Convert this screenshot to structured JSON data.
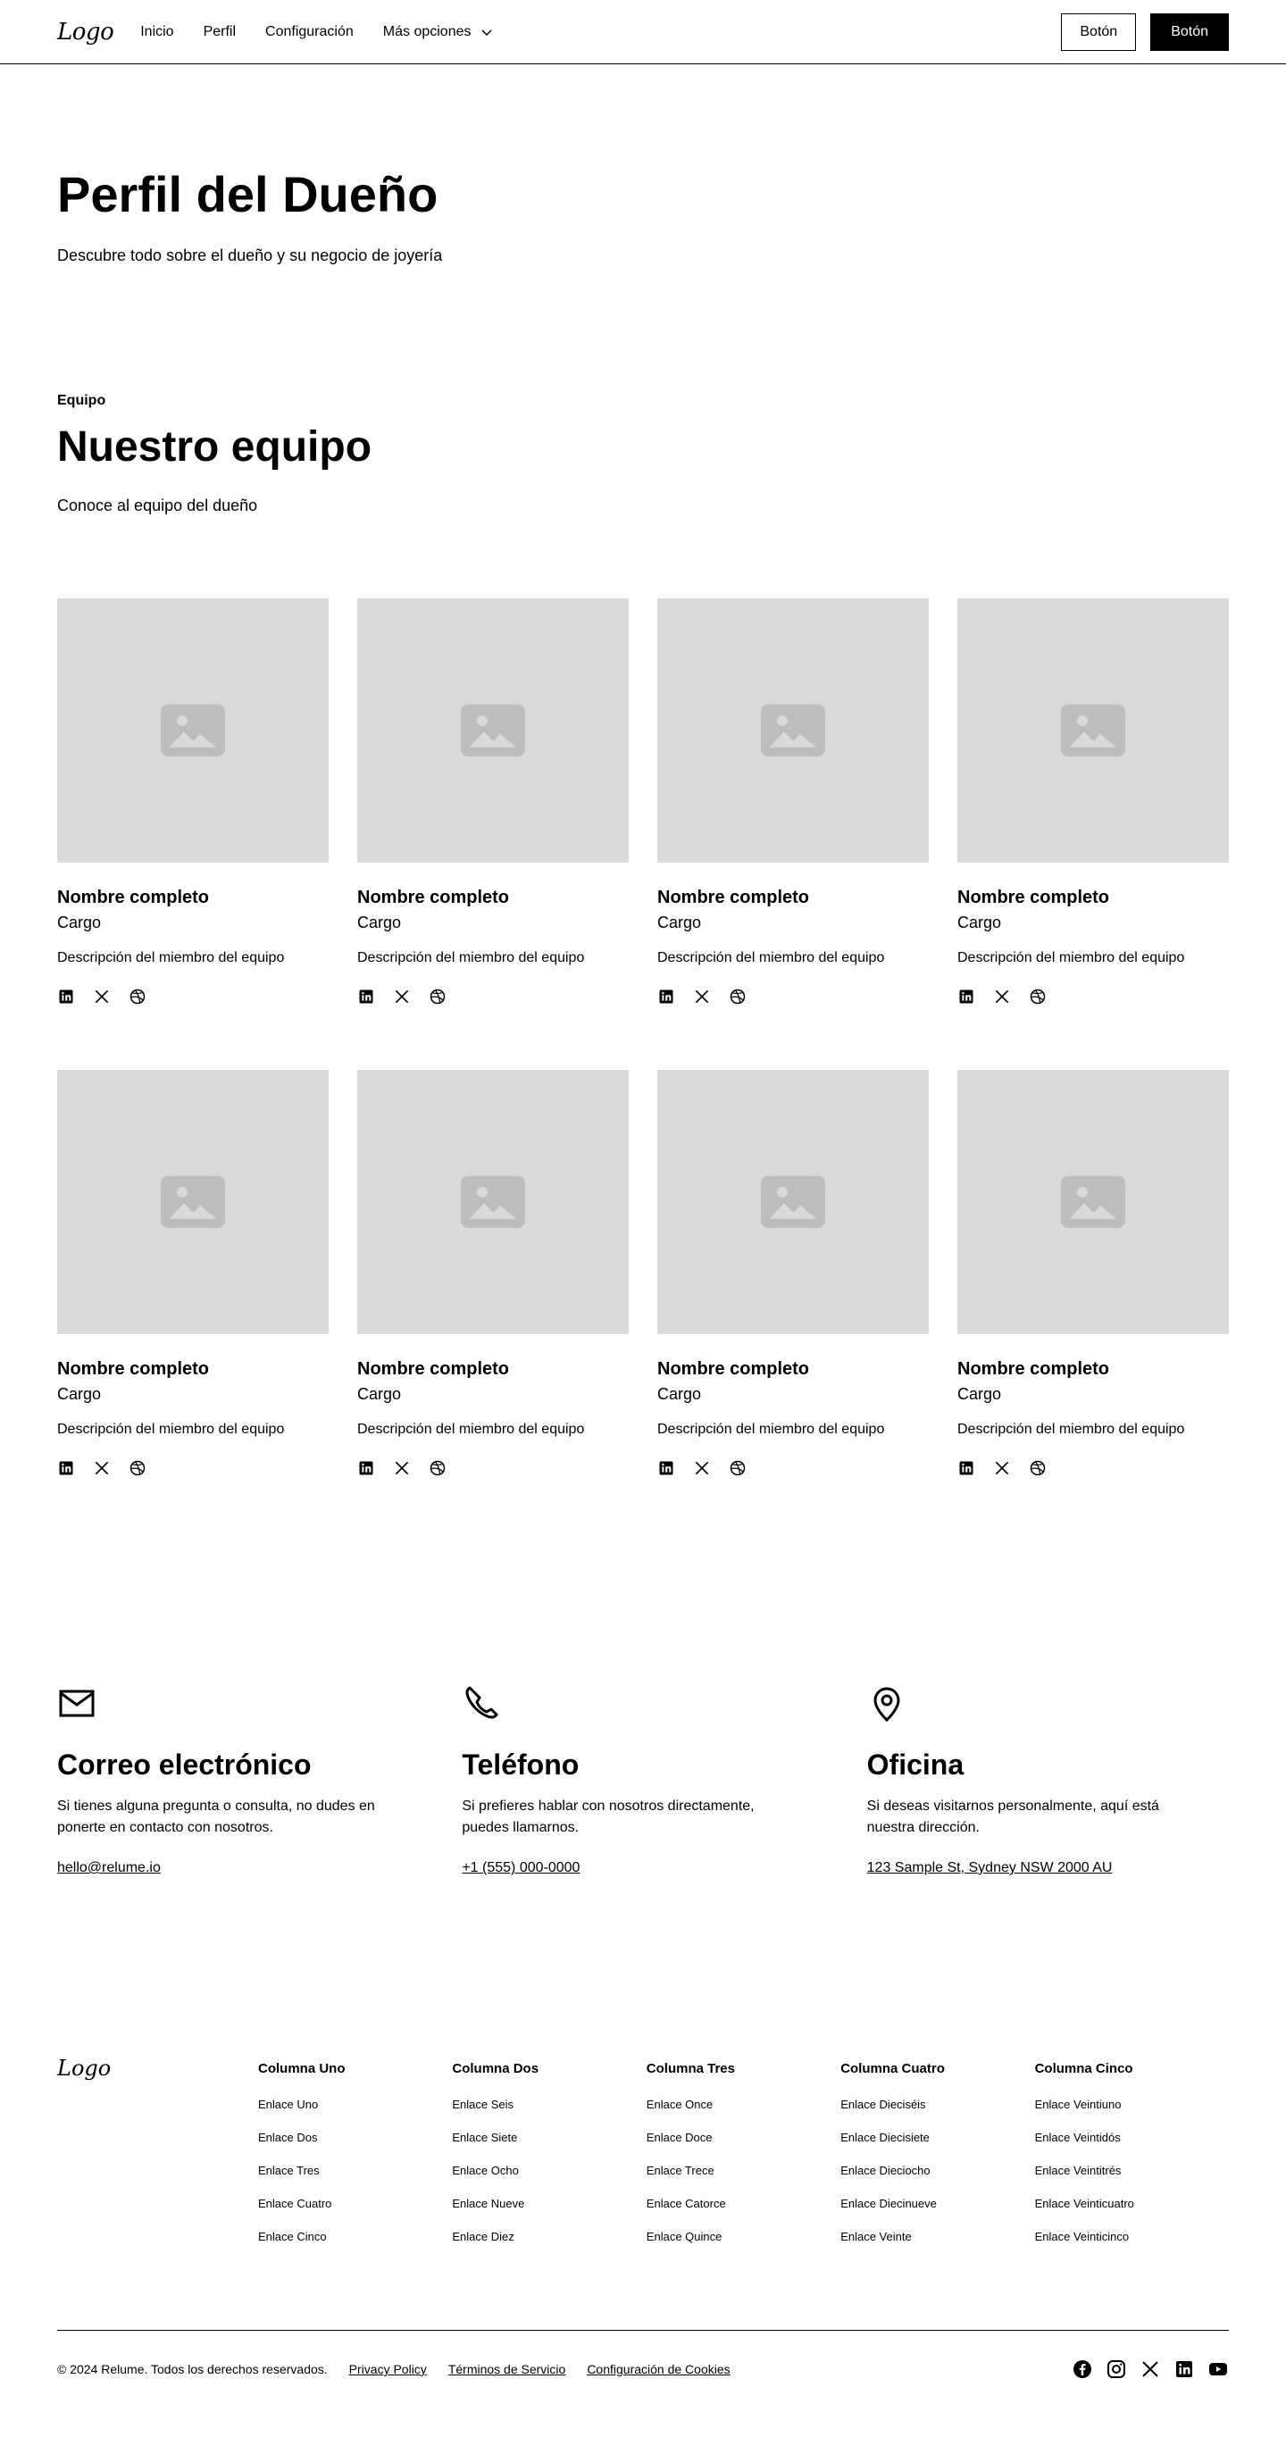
{
  "nav": {
    "logo": "Logo",
    "links": [
      "Inicio",
      "Perfil",
      "Configuración"
    ],
    "more": "Más opciones",
    "button_secondary": "Botón",
    "button_primary": "Botón"
  },
  "header": {
    "title": "Perfil del Dueño",
    "subtitle": "Descubre todo sobre el dueño y su negocio de joyería"
  },
  "team": {
    "tagline": "Equipo",
    "title": "Nuestro equipo",
    "subtitle": "Conoce al equipo del dueño",
    "members": [
      {
        "name": "Nombre completo",
        "role": "Cargo",
        "description": "Descripción del miembro del equipo"
      },
      {
        "name": "Nombre completo",
        "role": "Cargo",
        "description": "Descripción del miembro del equipo"
      },
      {
        "name": "Nombre completo",
        "role": "Cargo",
        "description": "Descripción del miembro del equipo"
      },
      {
        "name": "Nombre completo",
        "role": "Cargo",
        "description": "Descripción del miembro del equipo"
      },
      {
        "name": "Nombre completo",
        "role": "Cargo",
        "description": "Descripción del miembro del equipo"
      },
      {
        "name": "Nombre completo",
        "role": "Cargo",
        "description": "Descripción del miembro del equipo"
      },
      {
        "name": "Nombre completo",
        "role": "Cargo",
        "description": "Descripción del miembro del equipo"
      },
      {
        "name": "Nombre completo",
        "role": "Cargo",
        "description": "Descripción del miembro del equipo"
      }
    ],
    "member_social_icons": [
      "linkedin-icon",
      "x-icon",
      "dribbble-icon"
    ]
  },
  "contact": [
    {
      "icon": "mail-icon",
      "title": "Correo electrónico",
      "text": "Si tienes alguna pregunta o consulta, no dudes en ponerte en contacto con nosotros.",
      "link": "hello@relume.io"
    },
    {
      "icon": "phone-icon",
      "title": "Teléfono",
      "text": "Si prefieres hablar con nosotros directamente, puedes llamarnos.",
      "link": "+1 (555) 000-0000"
    },
    {
      "icon": "map-pin-icon",
      "title": "Oficina",
      "text": "Si deseas visitarnos personalmente, aquí está nuestra dirección.",
      "link": "123 Sample St, Sydney NSW 2000 AU"
    }
  ],
  "footer": {
    "logo": "Logo",
    "columns": [
      {
        "title": "Columna Uno",
        "links": [
          "Enlace Uno",
          "Enlace Dos",
          "Enlace Tres",
          "Enlace Cuatro",
          "Enlace Cinco"
        ]
      },
      {
        "title": "Columna Dos",
        "links": [
          "Enlace Seis",
          "Enlace Siete",
          "Enlace Ocho",
          "Enlace Nueve",
          "Enlace Diez"
        ]
      },
      {
        "title": "Columna Tres",
        "links": [
          "Enlace Once",
          "Enlace Doce",
          "Enlace Trece",
          "Enlace Catorce",
          "Enlace Quince"
        ]
      },
      {
        "title": "Columna Cuatro",
        "links": [
          "Enlace Dieciséis",
          "Enlace Diecisiete",
          "Enlace Dieciocho",
          "Enlace Diecinueve",
          "Enlace Veinte"
        ]
      },
      {
        "title": "Columna Cinco",
        "links": [
          "Enlace Veintiuno",
          "Enlace Veintidós",
          "Enlace Veintitrés",
          "Enlace Veinticuatro",
          "Enlace Veinticinco"
        ]
      }
    ],
    "copyright": "© 2024 Relume. Todos los derechos reservados.",
    "legal_links": [
      "Privacy Policy",
      "Términos de Servicio",
      "Configuración de Cookies"
    ],
    "social_icons": [
      "facebook-icon",
      "instagram-icon",
      "x-icon",
      "linkedin-icon",
      "youtube-icon"
    ]
  }
}
